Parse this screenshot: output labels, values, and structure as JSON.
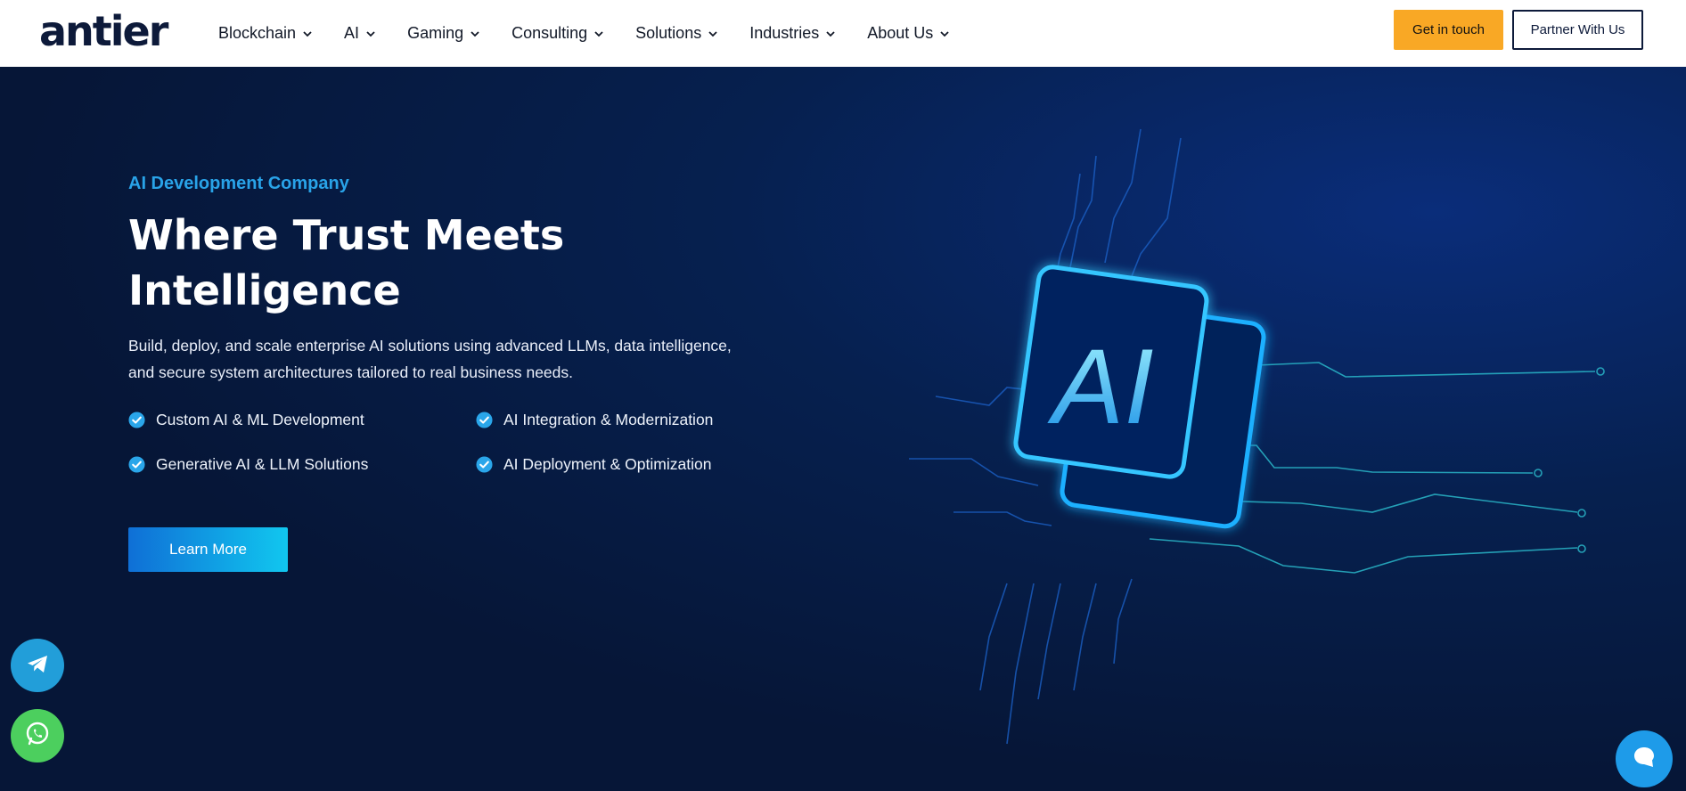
{
  "brand": {
    "logo_text": "antier"
  },
  "nav": {
    "items": [
      {
        "label": "Blockchain"
      },
      {
        "label": "AI"
      },
      {
        "label": "Gaming"
      },
      {
        "label": "Consulting"
      },
      {
        "label": "Solutions"
      },
      {
        "label": "Industries"
      },
      {
        "label": "About Us"
      }
    ],
    "cta_primary": "Get in touch",
    "cta_secondary": "Partner With Us"
  },
  "hero": {
    "eyebrow": "AI Development Company",
    "headline_line1": "Where Trust Meets",
    "headline_line2": "Intelligence",
    "description": "Build, deploy, and scale enterprise AI solutions using advanced LLMs, data intelligence, and secure system architectures tailored to real business needs.",
    "features": [
      "Custom AI & ML Development",
      "AI Integration & Modernization",
      "Generative AI & LLM Solutions",
      "AI Deployment & Optimization"
    ],
    "button_label": "Learn More",
    "art_text": "AI"
  },
  "colors": {
    "accent": "#29a3e8",
    "cta_yellow": "#f9a825",
    "navy": "#0d1a3a",
    "hero_bg": "#061637"
  },
  "icons": {
    "telegram": "telegram-icon",
    "whatsapp": "whatsapp-icon",
    "chat": "chat-bubble-icon",
    "check": "check-circle-icon",
    "chevron": "chevron-down-icon"
  }
}
